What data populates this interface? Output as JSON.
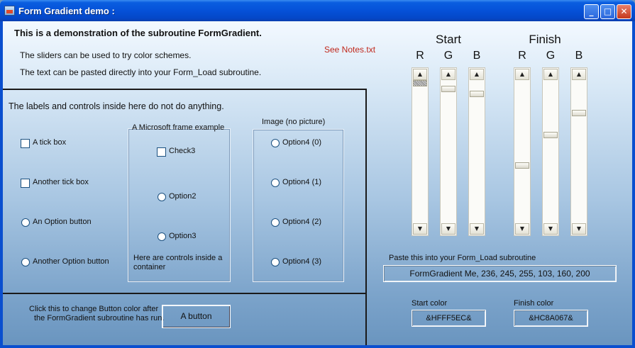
{
  "window": {
    "title": "Form Gradient demo :"
  },
  "intro": {
    "heading": "This is a demonstration of the subroutine  FormGradient.",
    "line1": "The sliders can be used to try color schemes.",
    "line2": "The text can be pasted directly into your Form_Load subroutine.",
    "notes_link": "See Notes.txt"
  },
  "controls_panel": {
    "caption": "The labels and controls inside here do not do anything.",
    "tick_box": "A tick box",
    "another_tick_box": "Another tick box",
    "option_button": "An Option button",
    "another_option_button": "Another Option button",
    "frame": {
      "title": "A Microsoft frame example",
      "check3": "Check3",
      "option2": "Option2",
      "option3": "Option3",
      "note": "Here are controls inside a container"
    },
    "image": {
      "title": "Image (no picture)",
      "options": [
        "Option4 (0)",
        "Option4 (1)",
        "Option4 (2)",
        "Option4 (3)"
      ]
    }
  },
  "button_panel": {
    "caption_line1": "Click this to change Button color after",
    "caption_line2": "the FormGradient subroutine has run.",
    "button_label": "A button"
  },
  "sliders": {
    "start_label": "Start",
    "finish_label": "Finish",
    "channels": [
      "R",
      "G",
      "B"
    ],
    "start_values": [
      255,
      245,
      236
    ],
    "finish_values": [
      103,
      160,
      200
    ],
    "max": 255
  },
  "output": {
    "paste_label": "Paste this into your  Form_Load subroutine",
    "code": "FormGradient Me, 236, 245, 255, 103, 160, 200",
    "start_color_label": "Start color",
    "start_color_value": "&HFFF5EC&",
    "finish_color_label": "Finish color",
    "finish_color_value": "&HC8A067&"
  },
  "colors": {
    "titlebar": "#0551d8",
    "link": "#c0281c"
  }
}
